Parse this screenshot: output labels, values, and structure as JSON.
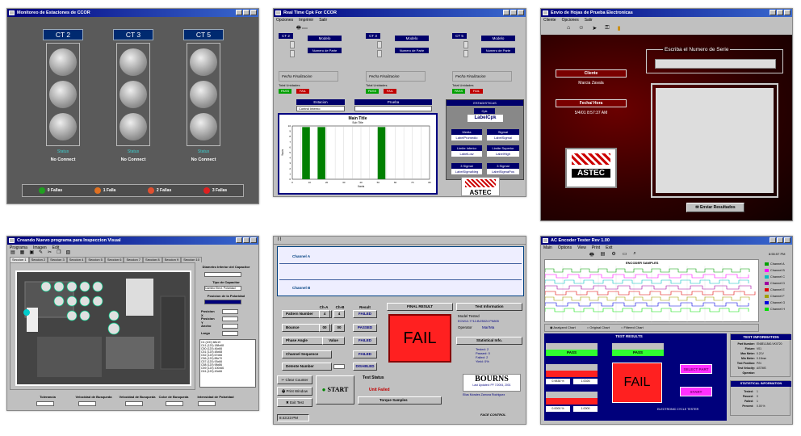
{
  "colors": {
    "dark_gray_bg": "#5a5a5a",
    "win_gray": "#c0c0c0",
    "navy": "#00006b",
    "fail_red": "#ff2020",
    "pass_green": "#00a000",
    "chart_green": "#008000",
    "magenta": "#ff30ff",
    "dark_red": "#2a0000"
  },
  "p1": {
    "title": "Monitoreo de Estaciones de CCOR",
    "stations": [
      {
        "label": "CT 2",
        "status": "Status",
        "conn": "No Connect"
      },
      {
        "label": "CT 3",
        "status": "Status",
        "conn": "No Connect"
      },
      {
        "label": "CT 5",
        "status": "Status",
        "conn": "No Connect"
      }
    ],
    "fails": [
      {
        "text": "0 Fallas",
        "color": "#20a020"
      },
      {
        "text": "1 Falla",
        "color": "#e07020"
      },
      {
        "text": "2 Fallas",
        "color": "#e05030"
      },
      {
        "text": "3 Fallas",
        "color": "#e02020"
      }
    ]
  },
  "p2": {
    "title": "Real Time Cpk For CCOR",
    "menu": [
      "Opciones",
      "Imprimir",
      "Salir"
    ],
    "cts": [
      {
        "name": "CT 2",
        "modelo": "Modelo",
        "parte": "Numero de Parte",
        "fin": "Fecha Finalizacion",
        "tot": "Total Unidades",
        "pass": "PASS",
        "fail": "FAIL"
      },
      {
        "name": "CT 3",
        "modelo": "Modelo",
        "parte": "Numero de Parte",
        "fin": "Fecha Finalizacion",
        "tot": "Total Unidades",
        "pass": "PASS",
        "fail": "FAIL"
      },
      {
        "name": "CT 5",
        "modelo": "Modelo",
        "parte": "Numero de Parte",
        "fin": "Fecha Finalizacion",
        "tot": "Total Unidades",
        "pass": "PASS",
        "fail": "FAIL"
      }
    ],
    "estacion_lbl": "Estacion",
    "estacion_val": "Control Interno",
    "prueba_lbl": "Prueba",
    "estadisticas": "ESTADISTICAS",
    "cpk": "Cpk",
    "label_cpk": "LabelCpk",
    "stat_btns": [
      "Media",
      "Sigmal",
      "Limite Inferior",
      "Limite Superior",
      "3 Sigmal",
      "3 Sigmal"
    ],
    "stat_vals": [
      "LabelPromedio",
      "LabelSigmal",
      "LabelLow",
      "LabelHigh",
      "LabelSigmaNeg",
      "LabelSigmaPos"
    ],
    "astec": "ASTEC"
  },
  "chart_data": {
    "type": "bar",
    "title": "Main Title",
    "subtitle": "Sub Title",
    "xlabel": "Xaxis",
    "ylabel": "Yaxis",
    "x": [
      5,
      10,
      15,
      20,
      25,
      30,
      35,
      40,
      45,
      50,
      55,
      60,
      65,
      70,
      75,
      80
    ],
    "bars": [
      {
        "x": 8,
        "value": 9.8
      },
      {
        "x": 17,
        "value": 9.8
      },
      {
        "x": 52,
        "value": 9.8
      }
    ],
    "ylim": [
      0,
      10
    ],
    "yticks": [
      "0",
      "1",
      "2",
      "3",
      "4",
      "5",
      "6",
      "7",
      "8",
      "9",
      "10"
    ],
    "xticks": [
      "0",
      "10",
      "20",
      "30",
      "40",
      "50",
      "60",
      "70",
      "80"
    ],
    "grid": true
  },
  "p3": {
    "title": "Envio de Hojas de Prueba Electronicas",
    "menu": [
      "Cliente",
      "Opciones",
      "Salir"
    ],
    "cliente_lbl": "Cliente",
    "cliente_val": "Marcia Zavala",
    "fecha_lbl": "Fecha/ Hora",
    "fecha_val": "5/4/01 8:57:37 AM",
    "serie_lbl": "Escriba el Numero de Serie",
    "astec": "ASTEC",
    "enviar": "Enviar Resultados"
  },
  "p4": {
    "title": "Creando Nuevo programa para Inspeccion Visual",
    "menu": [
      "Programa",
      "Imagen",
      "Edit"
    ],
    "tabs": [
      "Seccion 1",
      "Seccion 2",
      "Seccion 3",
      "Seccion 4",
      "Seccion 5",
      "Seccion 6",
      "Seccion 7",
      "Seccion 8",
      "Seccion 9",
      "Seccion 10"
    ],
    "right_labels": [
      "Diametro Inferior del Capacitor",
      "Tipo de Capacitor",
      "Posicion de la Polaridad",
      "Posicion X",
      "Posicion Y",
      "Ancho",
      "Largo"
    ],
    "tipo_val": "Cambio Elect. Polaridad",
    "bottom_labels": [
      "Tolerancia",
      "Velocidad de Busqueda",
      "Velocidad de Busqueda",
      "Color de Busqueda",
      "Intensidad de Polaridad"
    ],
    "list": [
      "C4 (100) 68x19",
      "C41 (120) 188x68",
      "C50 (120) 46x66",
      "C51 (120) 48x68",
      "C52 (120) 67x66",
      "C56 (120) 88x70",
      "C57 (120) 93x66",
      "C58 (120) 98x86",
      "C59 (120) 100x66",
      "C61 (120) 43x66"
    ]
  },
  "p5": {
    "channel_a": "Channel A",
    "channel_b": "Channel B",
    "col_cha": "Ch-A",
    "col_chb": "Ch-B",
    "col_result": "Result",
    "rows": [
      {
        "label": "Pattern Number",
        "a": "4",
        "b": "4",
        "result": "FAILED"
      },
      {
        "label": "Bounce",
        "a": "00",
        "b": "00",
        "result": "PASSED"
      },
      {
        "label": "Phase Angle",
        "a": "",
        "b": "Value",
        "result": "FAILED"
      },
      {
        "label": "Channel Sequence",
        "a": "",
        "b": "",
        "result": "FAILED"
      },
      {
        "label": "Detente Number",
        "a": "",
        "b": "",
        "result": "DISABLED"
      }
    ],
    "final_result_lbl": "FINAL RESULT",
    "fail": "FAIL",
    "test_info": "Test Information",
    "model_tested": "Model Tested",
    "model_val": "ECW12-7712-B/25024 PN805",
    "operator_lbl": "Operator",
    "operator_val": "Mar/Ma",
    "stat_info": "Statistical Info.",
    "stat_lines": [
      "Tested: 2",
      "Passed: 0",
      "Failed: 2",
      "Yield: 0%"
    ],
    "clear": "Clear Counter",
    "print": "Print Window",
    "exit": "Exit Test",
    "start": "START",
    "test_status": "Test Status",
    "status_val": "Unit Failed",
    "torque": "Torque Samples",
    "time": "8:43:23 PM",
    "bourns": "BOURNS",
    "bourns_sub": "Last Updated: PF 7/2004, 2001",
    "face": "FACE CONTROL",
    "face_sub": "Elias Morales Zamora Rodriguez"
  },
  "p6": {
    "title": "AC Encoder Tester Rev 1.00",
    "menu": [
      "Main",
      "Options",
      "View",
      "Print",
      "Exit"
    ],
    "time": "8:55:57 PM",
    "plot_title": "ENCODER SAMPLES",
    "legend": [
      "Channel A",
      "Channel B",
      "Channel C",
      "Channel D",
      "Channel E",
      "Channel F",
      "Channel G",
      "Channel H"
    ],
    "legend_colors": [
      "#00a000",
      "#ff00ff",
      "#00c0c0",
      "#a000a0",
      "#e00000",
      "#a0a000",
      "#0000e0",
      "#00e000"
    ],
    "radio": [
      "Analyzed Chart",
      "Original Chart",
      "Filtered Chart"
    ],
    "test_results": "TEST RESULTS",
    "test_info": "TEST INFORMATION",
    "stat_info": "STATISTICAL INFORMATION",
    "pass1": "PASS",
    "pass2": "PASS",
    "fail": "FAIL",
    "select": "SELECT PART",
    "start": "START",
    "info_labels": [
      "Part Number:",
      "Fixture:",
      "Max Meter:",
      "Min Meter:",
      "Test Position:",
      "Test Velocity:",
      "Operator:"
    ],
    "info_vals": [
      "EN8EL1840-VK0720",
      "V01",
      "0.21V",
      "0.19mm",
      "P/N",
      "ASTMS",
      ""
    ],
    "stat_labels": [
      "Tested:",
      "Passed:",
      "Failed:",
      "Percent:"
    ],
    "stat_vals": [
      "1",
      "0",
      "1",
      "0.00 %"
    ],
    "bottom_vals": [
      "0.9838 %",
      "1.0026",
      "0.0000 %",
      "1.0000"
    ],
    "cycle": "ELECTRONIC CYCLE TESTER"
  }
}
